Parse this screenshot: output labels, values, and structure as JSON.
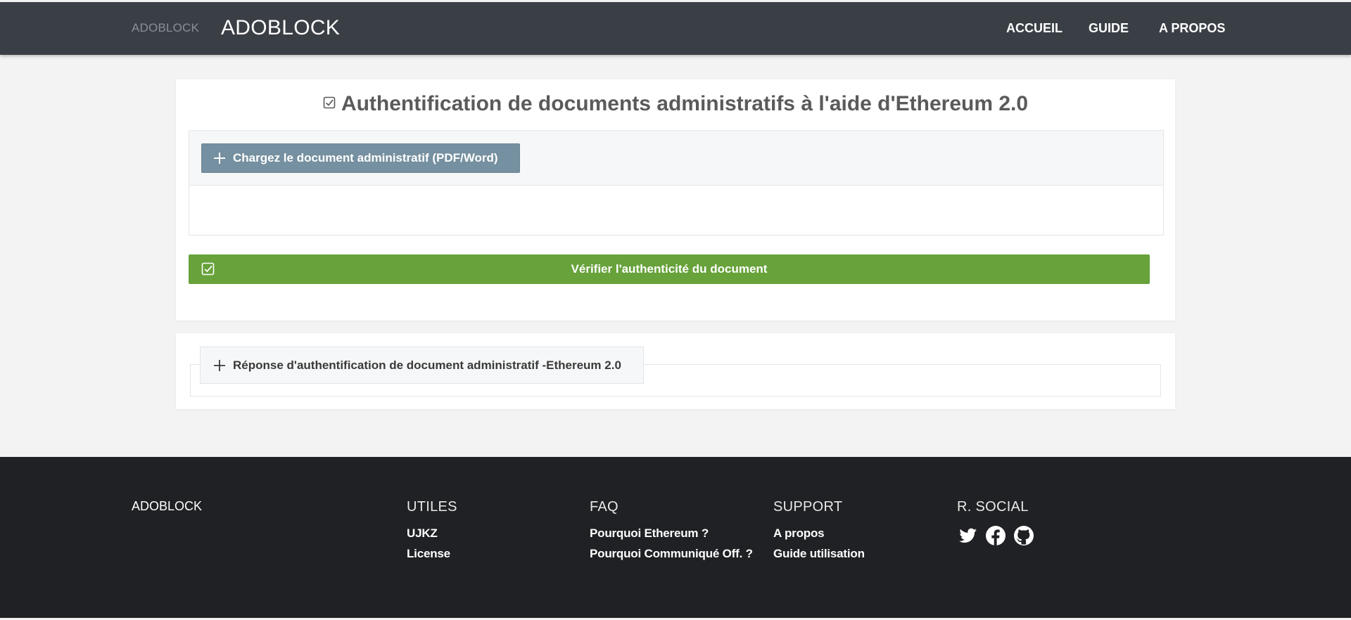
{
  "navbar": {
    "brand_small": "ADOBLOCK",
    "brand": "ADOBLOCK",
    "links": [
      {
        "label": "ACCUEIL"
      },
      {
        "label": "GUIDE"
      },
      {
        "label": "A PROPOS"
      }
    ]
  },
  "main": {
    "title": "Authentification de documents administratifs à l'aide d'Ethereum 2.0",
    "upload_label": "Chargez le document administratif (PDF/Word)",
    "verify_label": "Vérifier l'authenticité du document"
  },
  "response": {
    "tab_label": "Réponse d'authentification de document administratif -Ethereum 2.0"
  },
  "footer": {
    "brand": "ADOBLOCK",
    "utiles": {
      "title": "UTILES",
      "links": [
        "UJKZ",
        "License"
      ]
    },
    "faq": {
      "title": "FAQ",
      "links": [
        "Pourquoi Ethereum ?",
        "Pourquoi Communiqué Off. ?"
      ]
    },
    "support": {
      "title": "SUPPORT",
      "links": [
        "A propos",
        "Guide utilisation"
      ]
    },
    "social": {
      "title": "R. SOCIAL",
      "icons": [
        "twitter-icon",
        "facebook-icon",
        "github-icon"
      ]
    }
  },
  "colors": {
    "navbar": "#3a3f46",
    "upload_button": "#7590a0",
    "verify_button": "#67a23a",
    "footer": "#202124"
  }
}
